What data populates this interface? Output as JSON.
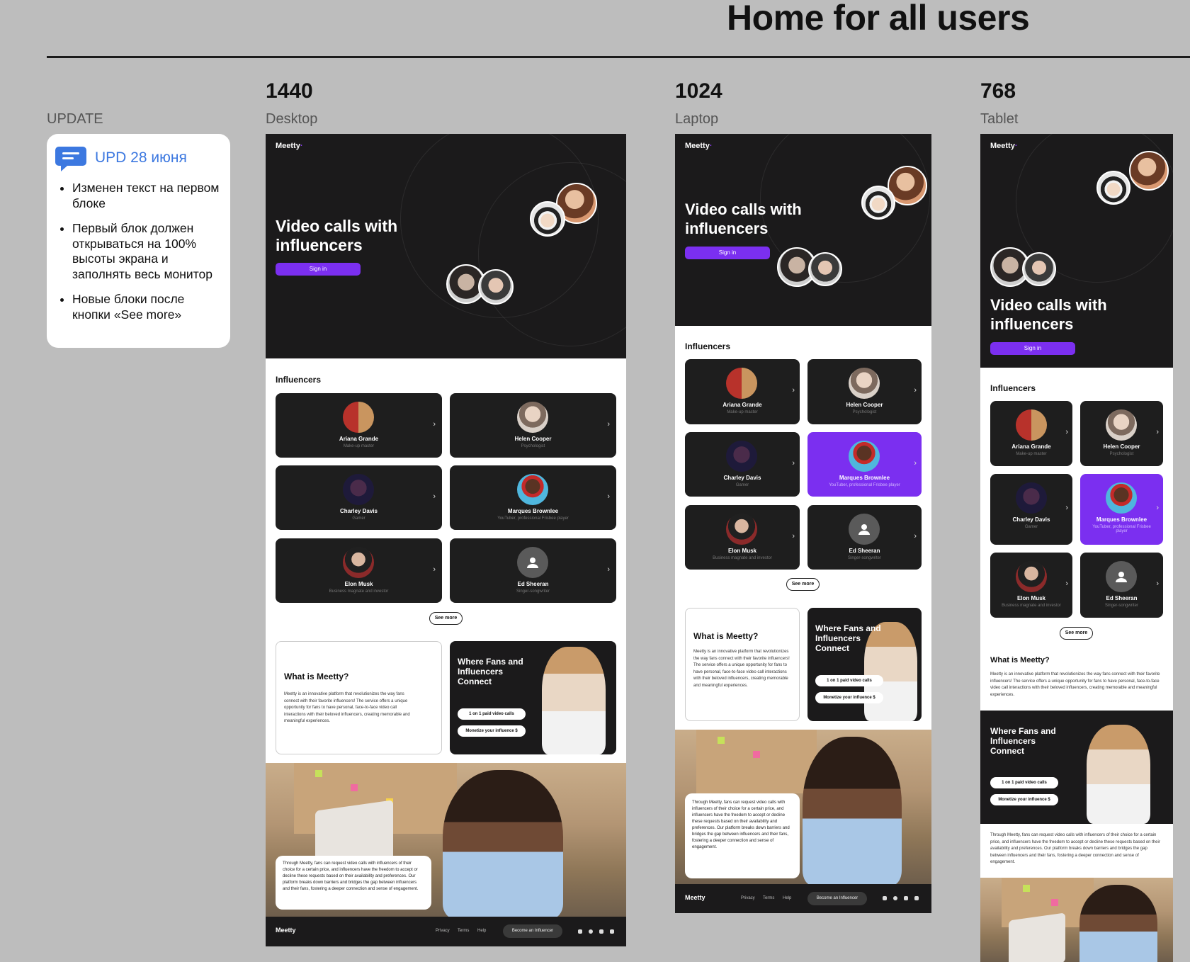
{
  "page": {
    "title": "Home for all users"
  },
  "update": {
    "label": "UPDATE",
    "title": "UPD 28 июня",
    "items": [
      "Изменен текст на первом блоке",
      "Первый блок должен открываться на 100% высоты экрана и заполнять весь монитор",
      "Новые блоки после кнопки «See more»"
    ]
  },
  "columns": [
    {
      "number": "1440",
      "label": "Desktop"
    },
    {
      "number": "1024",
      "label": "Laptop"
    },
    {
      "number": "768",
      "label": "Tablet"
    }
  ],
  "brand": {
    "logo": "Meetty",
    "accent": "#7b2ff0",
    "dark": "#1b1a1b"
  },
  "hero": {
    "title_line1": "Video calls with",
    "title_line2": "influencers",
    "signin": "Sign in"
  },
  "influencers": {
    "title": "Influencers",
    "cards": [
      {
        "name": "Ariana Grande",
        "role": "Make-up master"
      },
      {
        "name": "Helen Cooper",
        "role": "Psychologist"
      },
      {
        "name": "Charley Davis",
        "role": "Gamer"
      },
      {
        "name": "Marques Brownlee",
        "role": "YouTuber, professional Frisbee player"
      },
      {
        "name": "Elon Musk",
        "role": "Business magnate and investor"
      },
      {
        "name": "Ed Sheeran",
        "role": "Singer-songwriter"
      }
    ],
    "see_more": "See more"
  },
  "what": {
    "title": "What is Meetty?",
    "text": "Meetty is an innovative platform that revolutionizes the way fans connect with their favorite influencers! The service offers a unique opportunity for fans to have personal, face-to-face video call interactions with their beloved influencers, creating memorable and meaningful experiences."
  },
  "fans": {
    "title_line1": "Where Fans and",
    "title_line2": "Influencers",
    "title_line3": "Connect",
    "pill1": "1 on 1 paid video calls",
    "pill2": "Monetize your influence $"
  },
  "through": {
    "text": "Through Meetty, fans can request video calls with influencers of their choice for a certain price, and influencers have the freedom to accept or decline these requests based on their availability and preferences. Our platform breaks down barriers and bridges the gap between influencers and their fans, fostering a deeper connection and sense of engagement."
  },
  "footer": {
    "logo": "Meetty",
    "privacy": "Privacy",
    "terms": "Terms",
    "help": "Help",
    "become": "Become an Influencer"
  }
}
